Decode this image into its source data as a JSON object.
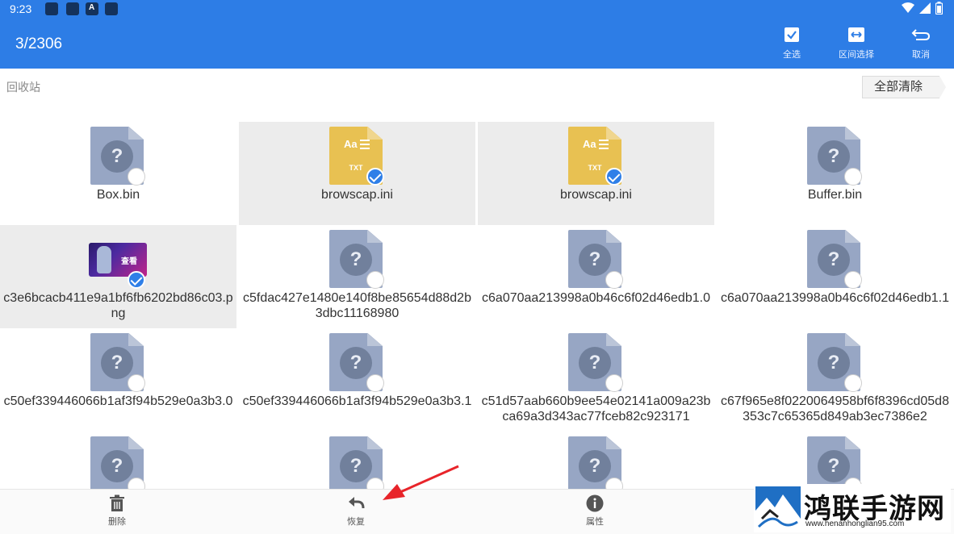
{
  "status_bar": {
    "time": "9:23",
    "notification_icons": [
      "app-icon",
      "app-icon",
      "a-icon",
      "app-icon"
    ]
  },
  "app_bar": {
    "selection_count": "3/2306",
    "actions": [
      {
        "label": "全选",
        "icon": "checkbox-icon"
      },
      {
        "label": "区间选择",
        "icon": "range-select-icon"
      },
      {
        "label": "取消",
        "icon": "undo-icon"
      }
    ]
  },
  "breadcrumb": "回收站",
  "clear_all_button": "全部清除",
  "files": [
    {
      "name": "Box.bin",
      "type": "unknown",
      "selected": false
    },
    {
      "name": "browscap.ini",
      "type": "txt",
      "selected": true
    },
    {
      "name": "browscap.ini",
      "type": "txt",
      "selected": true
    },
    {
      "name": "Buffer.bin",
      "type": "unknown",
      "selected": false
    },
    {
      "name": "c3e6bcacb411e9a1bf6fb6202bd86c03.png",
      "type": "image",
      "selected": true
    },
    {
      "name": "c5fdac427e1480e140f8be85654d88d2b3dbc11168980",
      "type": "unknown",
      "selected": false
    },
    {
      "name": "c6a070aa213998a0b46c6f02d46edb1.0",
      "type": "unknown",
      "selected": false
    },
    {
      "name": "c6a070aa213998a0b46c6f02d46edb1.1",
      "type": "unknown",
      "selected": false
    },
    {
      "name": "c50ef339446066b1af3f94b529e0a3b3.0",
      "type": "unknown",
      "selected": false
    },
    {
      "name": "c50ef339446066b1af3f94b529e0a3b3.1",
      "type": "unknown",
      "selected": false
    },
    {
      "name": "c51d57aab660b9ee54e02141a009a23bca69a3d343ac77fceb82c923171",
      "type": "unknown",
      "selected": false
    },
    {
      "name": "c67f965e8f0220064958bf6f8396cd05d8353c7c65365d849ab3ec7386e2",
      "type": "unknown",
      "selected": false
    },
    {
      "name": "",
      "type": "unknown",
      "selected": false
    },
    {
      "name": "",
      "type": "unknown",
      "selected": false
    },
    {
      "name": "",
      "type": "unknown",
      "selected": false
    },
    {
      "name": "",
      "type": "unknown",
      "selected": false
    }
  ],
  "file_icon_text": {
    "unknown_glyph": "?",
    "txt_glyph": "Aa",
    "txt_ext": "TXT",
    "image_thumb_text": "查看"
  },
  "bottom_bar": [
    {
      "label": "删除",
      "icon": "trash-icon"
    },
    {
      "label": "恢复",
      "icon": "restore-icon"
    },
    {
      "label": "属性",
      "icon": "info-icon"
    }
  ],
  "watermark": {
    "name": "鸿联手游网",
    "url": "www.henanhonglian95.com"
  },
  "colors": {
    "app_bar": "#2d7de6",
    "selected_cell": "#ececec",
    "check_on": "#2f7fe8",
    "unknown_icon": "#97a6c4",
    "txt_icon": "#e8c152",
    "annotation_arrow": "#e8242a"
  }
}
